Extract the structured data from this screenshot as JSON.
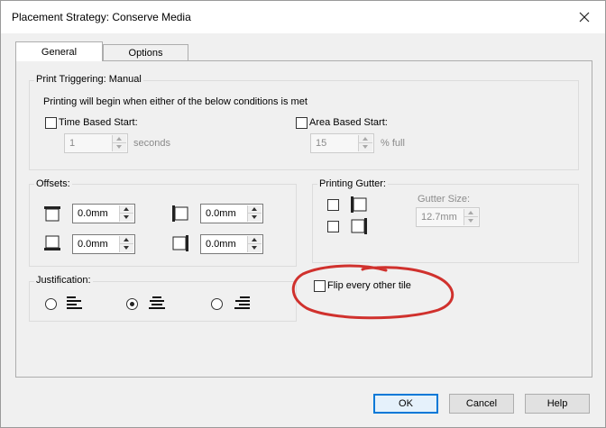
{
  "window": {
    "title": "Placement Strategy: Conserve Media"
  },
  "tabs": [
    {
      "label": "General",
      "active": true
    },
    {
      "label": "Options",
      "active": false
    }
  ],
  "print_triggering": {
    "label": "Print Triggering: Manual",
    "description": "Printing will begin when either of the below conditions is met",
    "time_based": {
      "label": "Time Based Start:",
      "checked": false,
      "value": "1",
      "unit": "seconds"
    },
    "area_based": {
      "label": "Area Based Start:",
      "checked": false,
      "value": "15",
      "unit": "% full"
    }
  },
  "offsets": {
    "label": "Offsets:",
    "top": "0.0mm",
    "left": "0.0mm",
    "bottom": "0.0mm",
    "right": "0.0mm"
  },
  "printing_gutter": {
    "label": "Printing Gutter:",
    "gutter_size_label": "Gutter Size:",
    "gutter_size_value": "12.7mm",
    "left_gutter_checked": false,
    "right_gutter_checked": false
  },
  "flip_every_other_tile": {
    "label": "Flip every other tile",
    "checked": false
  },
  "justification": {
    "label": "Justification:",
    "options": [
      "left",
      "center",
      "right"
    ],
    "selected": "center"
  },
  "buttons": {
    "ok": "OK",
    "cancel": "Cancel",
    "help": "Help"
  },
  "colors": {
    "annotation": "#d0312d",
    "default_button_border": "#0078d7"
  },
  "icons": {
    "close": "close-icon",
    "offset_top": "offset-top-icon",
    "offset_left": "offset-left-icon",
    "offset_bottom": "offset-bottom-icon",
    "offset_right": "offset-right-icon",
    "gutter_left": "gutter-left-icon",
    "gutter_right": "gutter-right-icon",
    "align_left": "align-left-icon",
    "align_center": "align-center-icon",
    "align_right": "align-right-icon"
  }
}
